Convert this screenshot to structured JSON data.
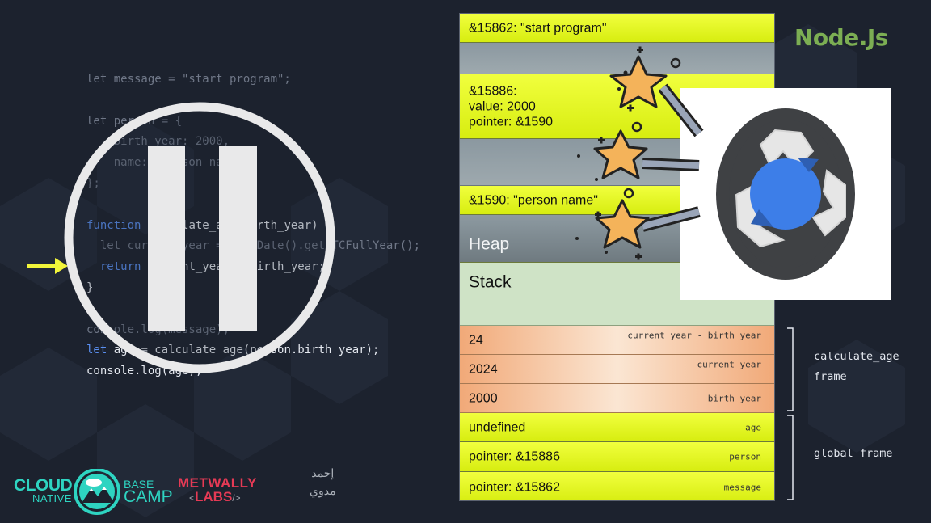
{
  "code": {
    "lines": [
      {
        "text": "let message = \"start program\";",
        "hl": false
      },
      {
        "text": "",
        "hl": false
      },
      {
        "text": "let person = {",
        "hl": false
      },
      {
        "text": "    birth_year: 2000,",
        "hl": false
      },
      {
        "text": "    name: \"person name\"",
        "hl": false
      },
      {
        "text": "};",
        "hl": false
      },
      {
        "text": "",
        "hl": false
      },
      {
        "kw": "function",
        "text": " calculate_age(birth_year) {",
        "hl": true
      },
      {
        "text": "  let current_year = new Date().getUTCFullYear();",
        "hl": false
      },
      {
        "kw": "  return",
        "text": " current_year - birth_year;",
        "hl": true
      },
      {
        "text": "}",
        "hl": true
      },
      {
        "text": "",
        "hl": false
      },
      {
        "text": "console.log(message);",
        "hl": false
      },
      {
        "kw": "let",
        "text": " age = calculate_age(person.birth_year);",
        "hl": true
      },
      {
        "text": "console.log(age);",
        "hl": true
      }
    ]
  },
  "memory": {
    "heap": [
      {
        "label": "&15862: \"start program\"",
        "style": "yellow"
      },
      {
        "label": "",
        "style": "gray"
      },
      {
        "label": "&15886:\nvalue: 2000\npointer: &1590",
        "style": "yellow"
      },
      {
        "label": "",
        "style": "gray"
      },
      {
        "label": "&1590: \"person name\"",
        "style": "yellow"
      }
    ],
    "heap_title": "Heap",
    "stack_title": "Stack",
    "stack": [
      {
        "value": "24",
        "var": "current_year - birth_year",
        "style": "orange"
      },
      {
        "value": "2024",
        "var": "current_year",
        "style": "orange"
      },
      {
        "value": "2000",
        "var": "birth_year",
        "style": "orange"
      },
      {
        "value": "undefined",
        "var": "age",
        "style": "yellow"
      },
      {
        "value": "pointer: &15886",
        "var": "person",
        "style": "yellow"
      },
      {
        "value": "pointer: &15862",
        "var": "message",
        "style": "yellow"
      }
    ]
  },
  "frames": {
    "calculate_age": "calculate_age\nframe",
    "global": "global frame"
  },
  "branding": {
    "node": "Node.Js",
    "cloud": "CLOUD",
    "native": "NATIVE",
    "base": "BASE",
    "camp": "CAMP",
    "metwally": "METWALLY",
    "labs": "LABS",
    "lt": "<",
    "gt": "/>",
    "signature": "إحمد\nمدوي"
  },
  "colors": {
    "background": "#1c222e",
    "node_green": "#7cae53",
    "cloud_teal": "#2ed4c1",
    "metwally_red": "#e53a55",
    "memory_yellow": "#e6f81c",
    "stack_frame_orange": "#f1a978",
    "gc_blue": "#3d7ee8"
  },
  "icons": [
    "pause-icon",
    "arrow-right-icon",
    "recycle-icon",
    "magic-wand-icon"
  ]
}
